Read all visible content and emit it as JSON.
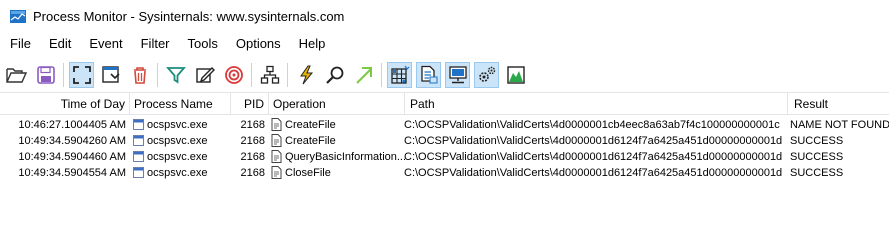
{
  "window": {
    "title": "Process Monitor - Sysinternals: www.sysinternals.com"
  },
  "menu": [
    "File",
    "Edit",
    "Event",
    "Filter",
    "Tools",
    "Options",
    "Help"
  ],
  "toolbar": {
    "buttons": [
      {
        "icon": "open-icon",
        "pressed": false
      },
      {
        "icon": "save-icon",
        "pressed": false
      },
      {
        "icon": "capture-icon",
        "pressed": true
      },
      {
        "icon": "autoscroll-icon",
        "pressed": false
      },
      {
        "icon": "clear-icon",
        "pressed": false
      },
      {
        "icon": "filter-icon",
        "pressed": false
      },
      {
        "icon": "highlight-icon",
        "pressed": false
      },
      {
        "icon": "bookmark-target-icon",
        "pressed": false
      },
      {
        "icon": "process-tree-icon",
        "pressed": false
      },
      {
        "icon": "event-properties-icon",
        "pressed": false
      },
      {
        "icon": "find-icon",
        "pressed": false
      },
      {
        "icon": "jump-to-icon",
        "pressed": false
      },
      {
        "icon": "registry-activity-icon",
        "pressed": true
      },
      {
        "icon": "file-activity-icon",
        "pressed": true
      },
      {
        "icon": "network-activity-icon",
        "pressed": true
      },
      {
        "icon": "process-activity-icon",
        "pressed": true
      },
      {
        "icon": "profiling-activity-icon",
        "pressed": false
      }
    ]
  },
  "columns": {
    "time": "Time of Day",
    "process": "Process Name",
    "pid": "PID",
    "operation": "Operation",
    "path": "Path",
    "result": "Result"
  },
  "rows": [
    {
      "time": "10:46:27.1004405 AM",
      "process": "ocspsvc.exe",
      "pid": "2168",
      "operation": "CreateFile",
      "path": "C:\\OCSPValidation\\ValidCerts\\4d0000001cb4eec8a63ab7f4c100000000001c",
      "result": "NAME NOT FOUND"
    },
    {
      "time": "10:49:34.5904260 AM",
      "process": "ocspsvc.exe",
      "pid": "2168",
      "operation": "CreateFile",
      "path": "C:\\OCSPValidation\\ValidCerts\\4d0000001d6124f7a6425a451d00000000001d",
      "result": "SUCCESS"
    },
    {
      "time": "10:49:34.5904460 AM",
      "process": "ocspsvc.exe",
      "pid": "2168",
      "operation": "QueryBasicInformation...",
      "path": "C:\\OCSPValidation\\ValidCerts\\4d0000001d6124f7a6425a451d00000000001d",
      "result": "SUCCESS"
    },
    {
      "time": "10:49:34.5904554 AM",
      "process": "ocspsvc.exe",
      "pid": "2168",
      "operation": "CloseFile",
      "path": "C:\\OCSPValidation\\ValidCerts\\4d0000001d6124f7a6425a451d00000000001d",
      "result": "SUCCESS"
    }
  ]
}
